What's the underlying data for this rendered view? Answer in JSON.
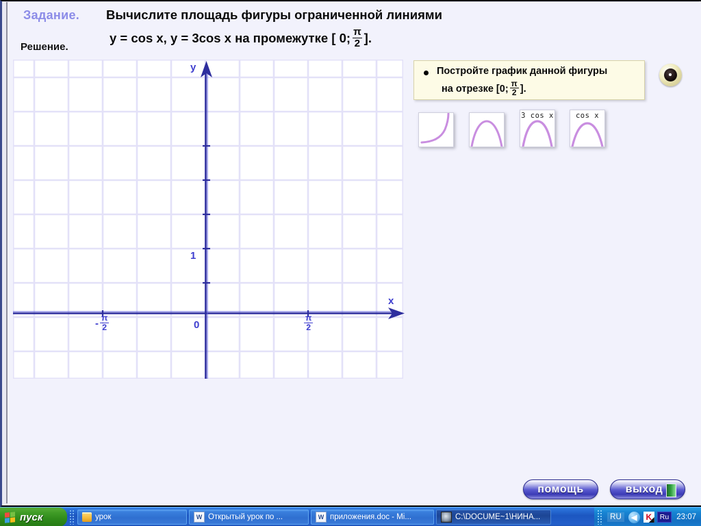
{
  "slide": {
    "header": {
      "zadanie_label": "Задание.",
      "reshenie_label": "Решение.",
      "task_line1": "Вычислите площадь фигуры ограниченной линиями",
      "task_line2_prefix": "y = cos x, y = 3cos x на промежутке [ 0;",
      "task_line2_num": "π",
      "task_line2_den": "2",
      "task_line2_suffix": "]."
    },
    "callout": {
      "line1": "Постройте график данной фигуры",
      "line2_prefix": "на отрезке [0;",
      "line2_num": "π",
      "line2_den": "2",
      "line2_suffix": "]."
    },
    "graph": {
      "y_axis_label": "y",
      "x_axis_label": "x",
      "origin_label": "0",
      "unit_label": "1",
      "neg_half_pi_sign": "-",
      "neg_half_pi_num": "π",
      "neg_half_pi_den": "2",
      "half_pi_num": "π",
      "half_pi_den": "2",
      "grid_color": "#e3e1f8",
      "axis_color": "#2e2e9e",
      "label_color": "#3f3fcf"
    },
    "thumbnails": [
      {
        "caption": "",
        "shape": "exp-curve"
      },
      {
        "caption": "",
        "shape": "arch-curve"
      },
      {
        "caption": "3 cos x",
        "shape": "arch-tall"
      },
      {
        "caption": "cos x",
        "shape": "arch-wide"
      }
    ],
    "curve_color": "#c98ee0",
    "eye_button_name": "eye-toggle",
    "buttons": {
      "help": "помощь",
      "exit": "выход"
    }
  },
  "taskbar": {
    "start_label": "пуск",
    "items": [
      {
        "label": "урок",
        "icon": "folder-icon",
        "active": false
      },
      {
        "label": "Открытый урок по ...",
        "icon": "word-icon",
        "active": false
      },
      {
        "label": "приложения.doc - Mi...",
        "icon": "word-icon",
        "active": false
      },
      {
        "label": "C:\\DOCUME~1\\НИНА...",
        "icon": "app-icon",
        "active": true
      }
    ],
    "tray": {
      "lang": "RU",
      "chevron": "◀",
      "kav": "K",
      "ru_badge": "Ru",
      "clock": "23:07"
    }
  }
}
